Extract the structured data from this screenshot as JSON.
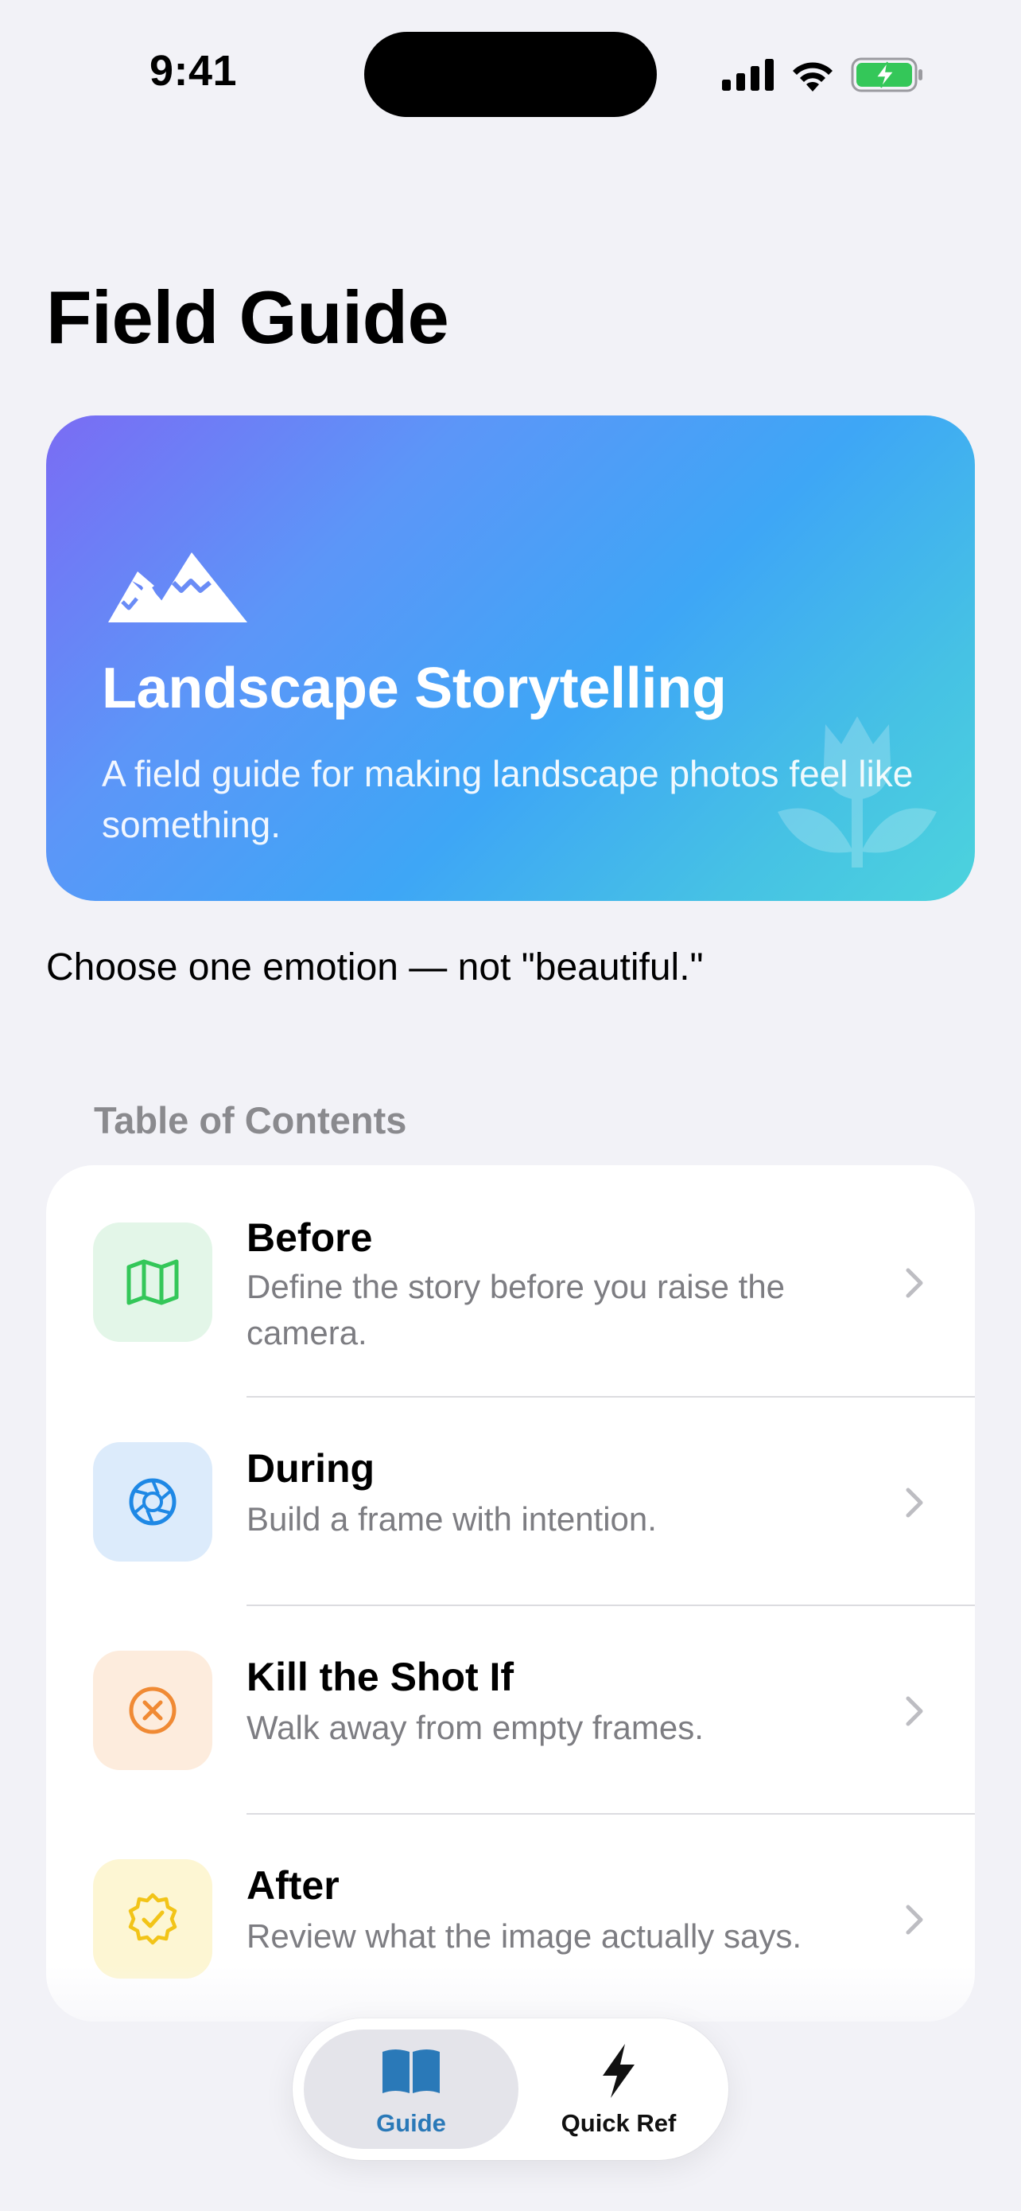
{
  "status_bar": {
    "time": "9:41"
  },
  "page": {
    "title": "Field Guide"
  },
  "hero": {
    "icon": "mountains-icon",
    "title": "Landscape Storytelling",
    "subtitle": "A field guide for making landscape photos feel like something.",
    "decoration_icon": "tulip-icon",
    "gradient": [
      "#7A6CF4",
      "#3EA6F6",
      "#4CD3DD"
    ]
  },
  "tagline": "Choose one emotion — not \"beautiful.\"",
  "toc": {
    "header": "Table of Contents",
    "items": [
      {
        "title": "Before",
        "description": "Define the story before you raise the camera.",
        "icon": "map-icon",
        "icon_color": "#34C759",
        "icon_bg": "#E3F6E8"
      },
      {
        "title": "During",
        "description": "Build a frame with intention.",
        "icon": "aperture-icon",
        "icon_color": "#1E88E5",
        "icon_bg": "#DCEBFB"
      },
      {
        "title": "Kill the Shot If",
        "description": "Walk away from empty frames.",
        "icon": "xmark-circle-icon",
        "icon_color": "#F08A34",
        "icon_bg": "#FDECDD"
      },
      {
        "title": "After",
        "description": "Review what the image actually says.",
        "icon": "checkmark-seal-icon",
        "icon_color": "#F2C418",
        "icon_bg": "#FDF6D3"
      }
    ]
  },
  "tab_bar": {
    "tabs": [
      {
        "label": "Guide",
        "icon": "book-icon",
        "selected": true
      },
      {
        "label": "Quick Ref",
        "icon": "bolt-icon",
        "selected": false
      }
    ],
    "accent": "#2A79B8"
  }
}
